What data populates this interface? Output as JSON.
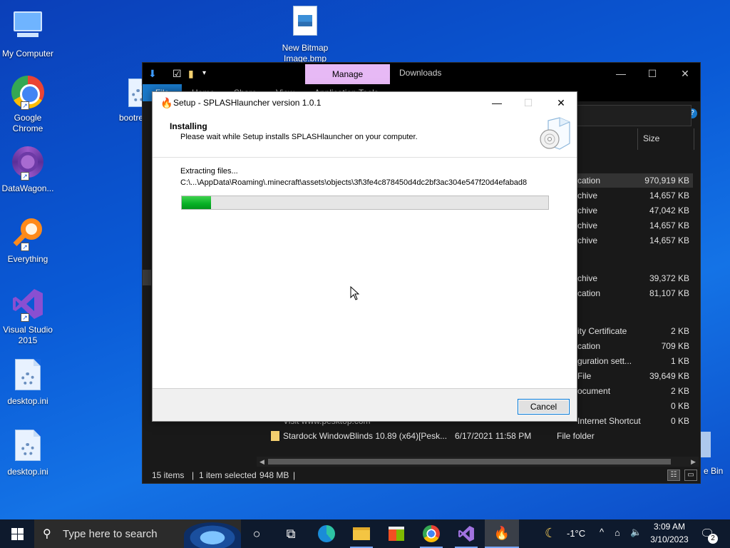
{
  "desktop": {
    "icons": [
      {
        "label": "My Computer"
      },
      {
        "label": "Google Chrome"
      },
      {
        "label": "DataWagon..."
      },
      {
        "label": "Everything"
      },
      {
        "label": "Visual Studio 2015"
      },
      {
        "label": "desktop.ini"
      },
      {
        "label": "desktop.ini"
      },
      {
        "label": "New Bitmap Image.bmp"
      },
      {
        "label": "bootre"
      }
    ],
    "recycle_bin_label": "e Bin"
  },
  "explorer": {
    "manage_tab": "Manage",
    "window_title": "Downloads",
    "ribbon_tabs": [
      "File",
      "Home",
      "Share",
      "View",
      "Application Tools"
    ],
    "size_header": "Size",
    "rows": [
      {
        "type": "cation",
        "size": "970,919 KB"
      },
      {
        "type": "chive",
        "size": "14,657 KB"
      },
      {
        "type": "chive",
        "size": "47,042 KB"
      },
      {
        "type": "chive",
        "size": "14,657 KB"
      },
      {
        "type": "chive",
        "size": "14,657 KB"
      },
      {
        "type": "chive",
        "size": "39,372 KB"
      },
      {
        "type": "cation",
        "size": "81,107 KB"
      },
      {
        "type": "ity Certificate",
        "size": "2 KB"
      },
      {
        "type": "cation",
        "size": "709 KB"
      },
      {
        "type": "guration sett...",
        "size": "1 KB"
      },
      {
        "type": "File",
        "size": "39,649 KB"
      },
      {
        "type": "ocument",
        "size": "2 KB"
      },
      {
        "type": "",
        "size": "0 KB"
      },
      {
        "type": "Internet Shortcut",
        "size": "0 KB"
      }
    ],
    "partial_row_name": "Visit www.pesktop.com",
    "last_row": {
      "name": "Stardock WindowBlinds 10.89 (x64)[Pesk...",
      "date": "6/17/2021 11:58 PM",
      "type": "File folder"
    },
    "status": {
      "items": "15 items",
      "selected": "1 item selected",
      "size": "948 MB"
    }
  },
  "setup": {
    "title": "Setup - SPLASHlauncher version 1.0.1",
    "heading": "Installing",
    "subheading": "Please wait while Setup installs SPLASHlauncher on your computer.",
    "status": "Extracting files...",
    "file_path": "C:\\...\\AppData\\Roaming\\.minecraft\\assets\\objects\\3f\\3fe4c878450d4dc2bf3ac304e547f20d4efabad8",
    "progress": 0.08,
    "cancel_label": "Cancel"
  },
  "taskbar": {
    "search_placeholder": "Type here to search",
    "weather": "-1°C",
    "time": "3:09 AM",
    "date": "3/10/2023",
    "notification_count": "2"
  },
  "colors": {
    "progress": "#06b025",
    "manage_tab": "#e7b9f5",
    "accent": "#0078d7"
  }
}
